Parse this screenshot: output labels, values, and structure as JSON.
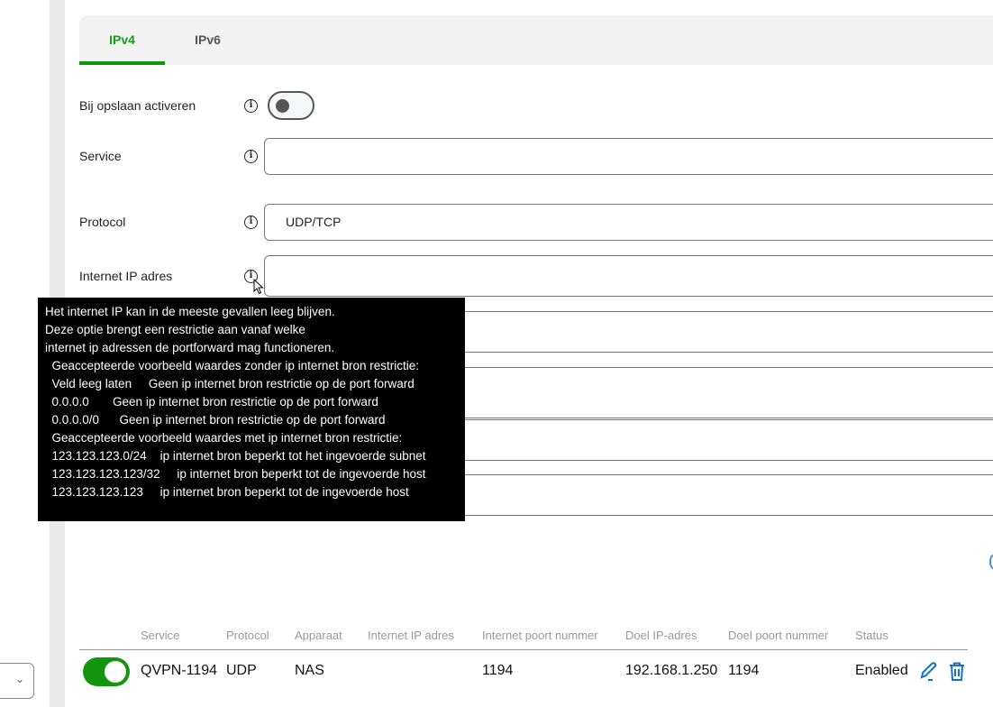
{
  "tabs": [
    {
      "label": "IPv4",
      "active": true
    },
    {
      "label": "IPv6",
      "active": false
    }
  ],
  "form": {
    "activate_label": "Bij opslaan activeren",
    "activate_on": false,
    "service_label": "Service",
    "service_value": "",
    "protocol_label": "Protocol",
    "protocol_value": "UDP/TCP",
    "internet_ip_label": "Internet IP adres",
    "internet_ip_value": ""
  },
  "tooltip": {
    "lines": [
      "Het internet IP kan in de meeste gevallen leeg blijven.",
      "Deze optie brengt een restrictie aan vanaf welke",
      "internet ip adressen de portforward mag functioneren.",
      "  Geaccepteerde voorbeeld waardes zonder ip internet bron restrictie:",
      "  Veld leeg laten     Geen ip internet bron restrictie op de port forward",
      "  0.0.0.0       Geen ip internet bron restrictie op de port forward",
      "  0.0.0.0/0      Geen ip internet bron restrictie op de port forward",
      "",
      "  Geaccepteerde voorbeeld waardes met ip internet bron restrictie:",
      "  123.123.123.0/24    ip internet bron beperkt tot het ingevoerde subnet",
      "  123.123.123.123/32     ip internet bron beperkt tot de ingevoerde host",
      "  123.123.123.123     ip internet bron beperkt tot de ingevoerde host"
    ]
  },
  "table": {
    "headers": [
      "Service",
      "Protocol",
      "Apparaat",
      "Internet IP adres",
      "Internet poort nummer",
      "Doel IP-adres",
      "Doel poort nummer",
      "Status"
    ],
    "rows": [
      {
        "enabled": true,
        "service": "QVPN-1194",
        "protocol": "UDP",
        "device": "NAS",
        "internet_ip": "",
        "internet_port": "1194",
        "target_ip": "192.168.1.250",
        "target_port": "1194",
        "status": "Enabled"
      }
    ]
  },
  "colors": {
    "accent": "#13960f",
    "icon_blue": "#1a6fc4"
  }
}
